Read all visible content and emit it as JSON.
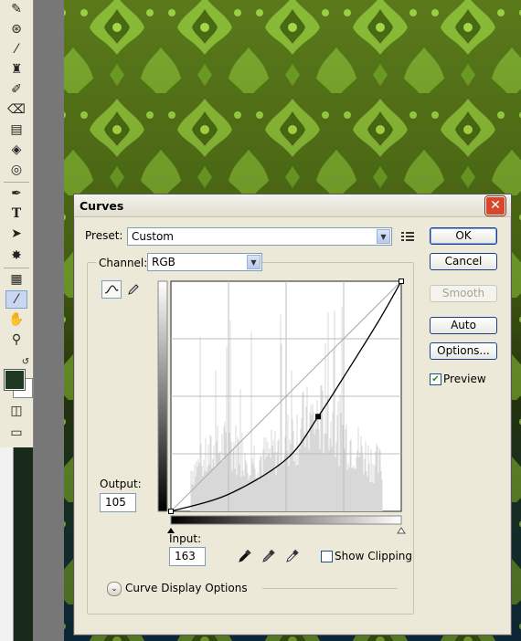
{
  "dialog": {
    "title": "Curves",
    "preset_label": "Preset:",
    "preset_value": "Custom",
    "channel_label": "Channel:",
    "channel_value": "RGB",
    "output_label": "Output:",
    "output_value": "105",
    "input_label": "Input:",
    "input_value": "163",
    "show_clipping_label": "Show Clipping",
    "show_clipping_checked": false,
    "curve_display_options_label": "Curve Display Options",
    "preview_label": "Preview",
    "preview_checked": true
  },
  "buttons": {
    "ok": "OK",
    "cancel": "Cancel",
    "smooth": "Smooth",
    "auto": "Auto",
    "options": "Options..."
  },
  "icons": {
    "close": "close-icon",
    "preset_options": "preset-options-icon",
    "curve_tool": "curve-tool-icon",
    "pencil_tool": "pencil-icon",
    "black_eyedropper": "black-point-eyedropper-icon",
    "gray_eyedropper": "gray-point-eyedropper-icon",
    "white_eyedropper": "white-point-eyedropper-icon",
    "expand": "expand-chevron-icon"
  },
  "chart_data": {
    "type": "line",
    "series": [
      {
        "x": [
          0,
          64,
          128,
          163,
          192,
          230,
          255
        ],
        "y": [
          0,
          19,
          58,
          105,
          150,
          211,
          255
        ]
      }
    ],
    "selected_point": {
      "x": 163,
      "y": 105
    },
    "xlim": [
      0,
      255
    ],
    "ylim": [
      0,
      255
    ],
    "grid": "4x4",
    "baseline": "diagonal"
  },
  "colors": {
    "foreground_swatch": "#1f3a22",
    "background_swatch": "#ffffff",
    "accent": "#1c3f8a"
  }
}
